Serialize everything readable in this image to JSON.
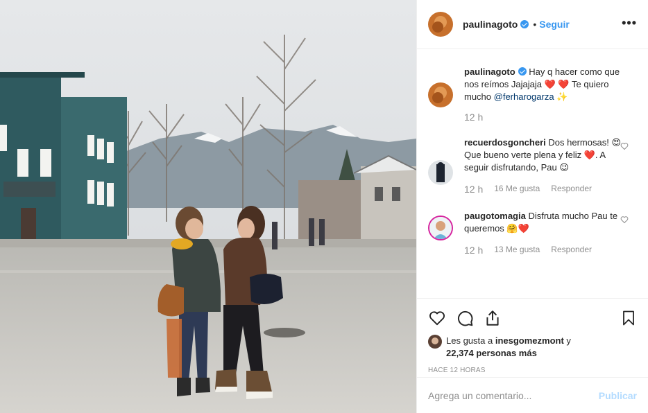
{
  "post": {
    "username": "paulinagoto",
    "follow_label": "Seguir",
    "separator": "•",
    "more_label": "•••"
  },
  "caption": {
    "username": "paulinagoto",
    "text_a": "Hay q hacer como que nos reímos Jajajaja ",
    "emoji_a": "❤️ ❤️",
    "text_b": " Te quiero mucho ",
    "mention": "@ferharogarza",
    "emoji_b": "✨",
    "time": "12 h"
  },
  "comments": [
    {
      "username": "recuerdosgoncheri",
      "text_a": "Dos hermosas! ",
      "emoji_a": "😍",
      "text_b": " Que bueno verte plena y feliz ",
      "emoji_b": "❤️",
      "text_c": ". A seguir disfrutando, Pau ",
      "emoji_c": "😉",
      "time": "12 h",
      "likes": "16 Me gusta",
      "reply": "Responder"
    },
    {
      "username": "paugotomagia",
      "text_a": "Disfruta mucho Pau te queremos ",
      "emoji_a": "🤗❤️",
      "time": "12 h",
      "likes": "13 Me gusta",
      "reply": "Responder"
    }
  ],
  "likes": {
    "prefix": "Les gusta a ",
    "user": "inesgomezmont",
    "middle": " y",
    "count": "22,374 personas más"
  },
  "time_ago": "HACE 12 HORAS",
  "add_comment": {
    "placeholder": "Agrega un comentario...",
    "publish": "Publicar"
  },
  "icons": {
    "like": "heart-icon",
    "comment": "comment-icon",
    "share": "share-icon",
    "save": "bookmark-icon",
    "verified": "verified-badge-icon",
    "options": "more-options-icon"
  },
  "colors": {
    "link": "#3897f0",
    "mention": "#00376b",
    "muted": "#8e8e8e",
    "publish_disabled": "#b3dbff"
  }
}
